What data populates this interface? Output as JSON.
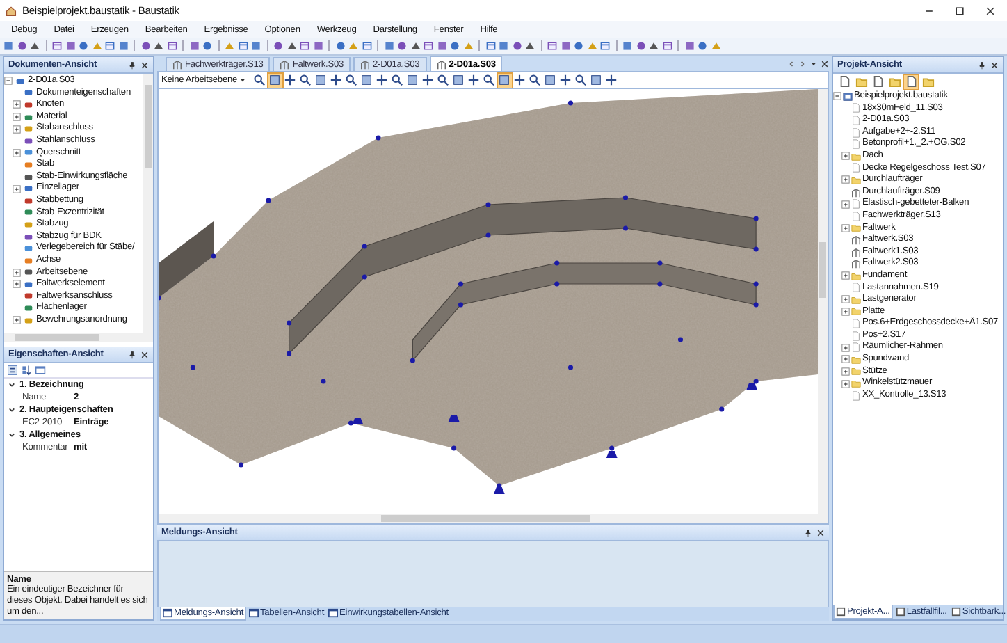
{
  "window": {
    "title": "Beispielprojekt.baustatik - Baustatik"
  },
  "menu": [
    "Debug",
    "Datei",
    "Erzeugen",
    "Bearbeiten",
    "Ergebnisse",
    "Optionen",
    "Werkzeug",
    "Darstellung",
    "Fenster",
    "Hilfe"
  ],
  "documents_panel": {
    "title": "Dokumenten-Ansicht",
    "tree": [
      {
        "label": "2-D01a.S03",
        "expanded": true,
        "children": [
          {
            "label": "Dokumenteigenschaften"
          },
          {
            "label": "Knoten",
            "expanded": false
          },
          {
            "label": "Material",
            "expanded": false
          },
          {
            "label": "Stabanschluss",
            "expanded": false
          },
          {
            "label": "Stahlanschluss"
          },
          {
            "label": "Querschnitt",
            "expanded": false
          },
          {
            "label": "Stab"
          },
          {
            "label": "Stab-Einwirkungsfläche"
          },
          {
            "label": "Einzellager",
            "expanded": false
          },
          {
            "label": "Stabbettung"
          },
          {
            "label": "Stab-Exzentrizität"
          },
          {
            "label": "Stabzug"
          },
          {
            "label": "Stabzug für BDK"
          },
          {
            "label": "Verlegebereich für Stäbe/"
          },
          {
            "label": "Achse"
          },
          {
            "label": "Arbeitsebene",
            "expanded": false
          },
          {
            "label": "Faltwerkselement",
            "expanded": false
          },
          {
            "label": "Faltwerksanschluss"
          },
          {
            "label": "Flächenlager"
          },
          {
            "label": "Bewehrungsanordnung",
            "expanded": false
          }
        ]
      }
    ]
  },
  "properties_panel": {
    "title": "Eigenschaften-Ansicht",
    "sections": [
      {
        "title": "1. Bezeichnung",
        "expanded": true,
        "rows": [
          {
            "name": "Name",
            "value": "2"
          }
        ]
      },
      {
        "title": "2. Haupteigenschaften",
        "expanded": true,
        "rows": [
          {
            "name": "EC2-2010",
            "value": "Einträge"
          }
        ]
      },
      {
        "title": "3. Allgemeines",
        "expanded": true,
        "rows": [
          {
            "name": "Kommentar",
            "value": "mit"
          }
        ]
      }
    ],
    "help": {
      "title": "Name",
      "text": "Ein eindeutiger Bezeichner für dieses Objekt. Dabei handelt es sich um den..."
    }
  },
  "document_tabs": [
    {
      "label": "Fachwerkträger.S13",
      "selected": false
    },
    {
      "label": "Faltwerk.S03",
      "selected": false
    },
    {
      "label": "2-D01a.S03",
      "selected": false
    },
    {
      "label": "2-D01a.S03",
      "selected": true
    }
  ],
  "view_toolbar": {
    "workplane": "Keine Arbeitsebene",
    "tools": [
      {
        "selected": false
      },
      {
        "selected": true
      },
      {
        "selected": false
      },
      {
        "selected": false
      },
      {
        "selected": false
      },
      {
        "selected": false
      },
      {
        "selected": false
      },
      {
        "selected": false
      },
      {
        "selected": false
      },
      {
        "selected": false
      },
      {
        "selected": false
      },
      {
        "selected": false
      },
      {
        "selected": false
      },
      {
        "selected": false
      },
      {
        "selected": false
      },
      {
        "selected": false
      },
      {
        "selected": true
      },
      {
        "selected": false
      },
      {
        "selected": false
      },
      {
        "selected": false
      },
      {
        "selected": false
      },
      {
        "selected": false
      },
      {
        "selected": false
      },
      {
        "selected": false
      }
    ]
  },
  "messages_panel": {
    "title": "Meldungs-Ansicht"
  },
  "bottom_tabs": [
    {
      "label": "Meldungs-Ansicht",
      "selected": true
    },
    {
      "label": "Tabellen-Ansicht",
      "selected": false
    },
    {
      "label": "Einwirkungstabellen-Ansicht",
      "selected": false
    }
  ],
  "project_panel": {
    "title": "Projekt-Ansicht",
    "tools": [
      {
        "selected": false
      },
      {
        "selected": false
      },
      {
        "selected": false
      },
      {
        "selected": false
      },
      {
        "selected": true
      },
      {
        "selected": false
      }
    ],
    "tree": [
      {
        "label": "Beispielprojekt.baustatik",
        "kind": "project",
        "expanded": true,
        "children": [
          {
            "label": "18x30mFeld_11.S03",
            "kind": "file"
          },
          {
            "label": "2-D01a.S03",
            "kind": "file"
          },
          {
            "label": "Aufgabe+2+-2.S11",
            "kind": "file"
          },
          {
            "label": "Betonprofil+1._2.+OG.S02",
            "kind": "file"
          },
          {
            "label": "Dach",
            "kind": "folder",
            "expanded": false
          },
          {
            "label": "Decke Regelgeschoss Test.S07",
            "kind": "file"
          },
          {
            "label": "Durchlaufträger",
            "kind": "folder",
            "expanded": false
          },
          {
            "label": "Durchlaufträger.S09",
            "kind": "model"
          },
          {
            "label": "Elastisch-gebetteter-Balken",
            "kind": "file",
            "expanded": false
          },
          {
            "label": "Fachwerkträger.S13",
            "kind": "file"
          },
          {
            "label": "Faltwerk",
            "kind": "folder",
            "expanded": false
          },
          {
            "label": "Faltwerk.S03",
            "kind": "model"
          },
          {
            "label": "Faltwerk1.S03",
            "kind": "model"
          },
          {
            "label": "Faltwerk2.S03",
            "kind": "model"
          },
          {
            "label": "Fundament",
            "kind": "folder",
            "expanded": false
          },
          {
            "label": "Lastannahmen.S19",
            "kind": "file"
          },
          {
            "label": "Lastgenerator",
            "kind": "folder",
            "expanded": false
          },
          {
            "label": "Platte",
            "kind": "folder",
            "expanded": false
          },
          {
            "label": "Pos.6+Erdgeschossdecke+Ä1.S07",
            "kind": "file"
          },
          {
            "label": "Pos+2.S17",
            "kind": "file"
          },
          {
            "label": "Räumlicher-Rahmen",
            "kind": "file",
            "expanded": false
          },
          {
            "label": "Spundwand",
            "kind": "folder",
            "expanded": false
          },
          {
            "label": "Stütze",
            "kind": "folder",
            "expanded": false
          },
          {
            "label": "Winkelstützmauer",
            "kind": "folder",
            "expanded": false
          },
          {
            "label": "XX_Kontrolle_13.S13",
            "kind": "file"
          }
        ]
      }
    ]
  },
  "project_tabs": [
    {
      "label": "Projekt-A...",
      "selected": true
    },
    {
      "label": "Lastfallfil...",
      "selected": false
    },
    {
      "label": "Sichtbark...",
      "selected": false
    }
  ]
}
